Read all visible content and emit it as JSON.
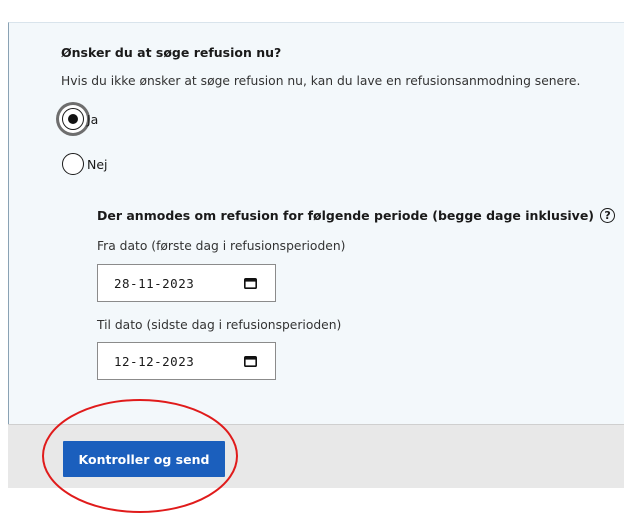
{
  "question": {
    "title": "Ønsker du at søge refusion nu?",
    "hint": "Hvis du ikke ønsker at søge refusion nu, kan du lave en refusionsanmodning senere."
  },
  "options": [
    {
      "label": "Ja",
      "checked": true
    },
    {
      "label": "Nej",
      "checked": false
    }
  ],
  "period": {
    "label": "Der anmodes om refusion for følgende periode (begge dage inklusive)",
    "help_icon": "question-circle-icon",
    "from": {
      "label": "Fra dato (første dag i refusionsperioden)",
      "value": "28-11-2023",
      "icon": "calendar-icon"
    },
    "to": {
      "label": "Til dato (sidste dag i refusionsperioden)",
      "value": "12-12-2023",
      "icon": "calendar-icon"
    }
  },
  "footer": {
    "submit_label": "Kontroller og send"
  },
  "colors": {
    "panel_bg": "#f3f8fb",
    "button_bg": "#1b5fbd",
    "annotation": "#e01b1b",
    "footer_bg": "#e8e8e8"
  }
}
